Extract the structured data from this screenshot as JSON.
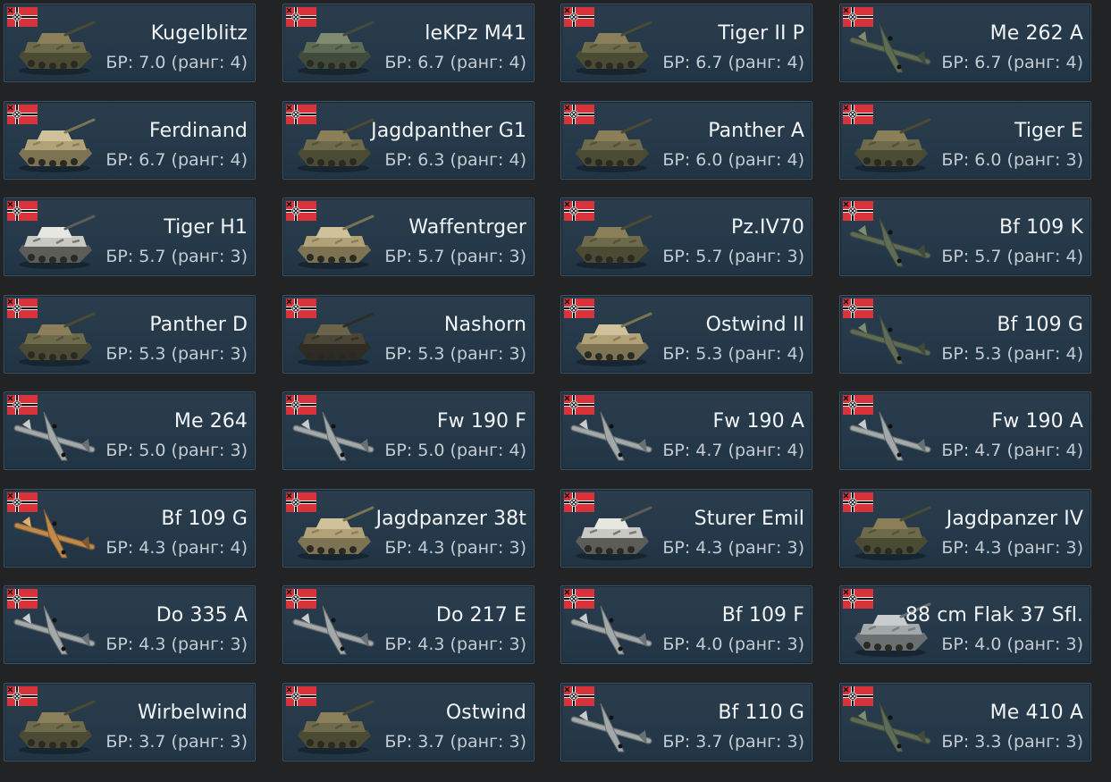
{
  "colors": {
    "background": "#222325",
    "card": "#25394a",
    "card_border": "#3a5366",
    "name_text": "#f2f4f5",
    "br_text": "#c4ccd2",
    "flag_red": "#d8323a"
  },
  "flag_icon": "german-war-flag-icon",
  "vehicles": [
    {
      "name": "Kugelblitz",
      "br": "БР: 7.0 (ранг: 4)",
      "kind": "tank",
      "tone": "camo"
    },
    {
      "name": "leKPz M41",
      "br": "БР: 6.7 (ранг: 4)",
      "kind": "tank",
      "tone": "green"
    },
    {
      "name": "Tiger II P",
      "br": "БР: 6.7 (ранг: 4)",
      "kind": "tank",
      "tone": "camo"
    },
    {
      "name": "Me 262 A",
      "br": "БР: 6.7 (ранг: 4)",
      "kind": "plane",
      "tone": "green"
    },
    {
      "name": "Ferdinand",
      "br": "БР: 6.7 (ранг: 4)",
      "kind": "tank",
      "tone": "sand"
    },
    {
      "name": "Jagdpanther G1",
      "br": "БР: 6.3 (ранг: 4)",
      "kind": "tank",
      "tone": "camo"
    },
    {
      "name": "Panther A",
      "br": "БР: 6.0 (ранг: 4)",
      "kind": "tank",
      "tone": "camo"
    },
    {
      "name": "Tiger E",
      "br": "БР: 6.0 (ранг: 3)",
      "kind": "tank",
      "tone": "camo"
    },
    {
      "name": "Tiger H1",
      "br": "БР: 5.7 (ранг: 3)",
      "kind": "tank",
      "tone": "white"
    },
    {
      "name": "Waffentrger",
      "br": "БР: 5.7 (ранг: 3)",
      "kind": "tank",
      "tone": "sand"
    },
    {
      "name": "Pz.IV70",
      "br": "БР: 5.7 (ранг: 3)",
      "kind": "tank",
      "tone": "camo"
    },
    {
      "name": "Bf 109 K",
      "br": "БР: 5.7 (ранг: 4)",
      "kind": "plane",
      "tone": "green"
    },
    {
      "name": "Panther D",
      "br": "БР: 5.3 (ранг: 3)",
      "kind": "tank",
      "tone": "camo"
    },
    {
      "name": "Nashorn",
      "br": "БР: 5.3 (ранг: 3)",
      "kind": "tank",
      "tone": "dark"
    },
    {
      "name": "Ostwind II",
      "br": "БР: 5.3 (ранг: 4)",
      "kind": "tank",
      "tone": "sand"
    },
    {
      "name": "Bf 109 G",
      "br": "БР: 5.3 (ранг: 4)",
      "kind": "plane",
      "tone": "green"
    },
    {
      "name": "Me 264",
      "br": "БР: 5.0 (ранг: 3)",
      "kind": "plane",
      "tone": "gray"
    },
    {
      "name": "Fw 190 F",
      "br": "БР: 5.0 (ранг: 4)",
      "kind": "plane",
      "tone": "gray"
    },
    {
      "name": "Fw 190 A",
      "br": "БР: 4.7 (ранг: 4)",
      "kind": "plane",
      "tone": "gray"
    },
    {
      "name": "Fw 190 A",
      "br": "БР: 4.7 (ранг: 4)",
      "kind": "plane",
      "tone": "gray"
    },
    {
      "name": "Bf 109 G",
      "br": "БР: 4.3 (ранг: 4)",
      "kind": "plane",
      "tone": "tan"
    },
    {
      "name": "Jagdpanzer 38t",
      "br": "БР: 4.3 (ранг: 3)",
      "kind": "tank",
      "tone": "sand"
    },
    {
      "name": "Sturer Emil",
      "br": "БР: 4.3 (ранг: 3)",
      "kind": "tank",
      "tone": "white"
    },
    {
      "name": "Jagdpanzer IV",
      "br": "БР: 4.3 (ранг: 3)",
      "kind": "tank",
      "tone": "camo"
    },
    {
      "name": "Do 335 A",
      "br": "БР: 4.3 (ранг: 3)",
      "kind": "plane",
      "tone": "gray"
    },
    {
      "name": "Do 217 E",
      "br": "БР: 4.3 (ранг: 3)",
      "kind": "plane",
      "tone": "gray"
    },
    {
      "name": "Bf 109 F",
      "br": "БР: 4.0 (ранг: 3)",
      "kind": "plane",
      "tone": "gray"
    },
    {
      "name": "88 cm Flak 37 Sfl.",
      "br": "БР: 4.0 (ранг: 3)",
      "kind": "tank",
      "tone": "gray"
    },
    {
      "name": "Wirbelwind",
      "br": "БР: 3.7 (ранг: 3)",
      "kind": "tank",
      "tone": "camo"
    },
    {
      "name": "Ostwind",
      "br": "БР: 3.7 (ранг: 3)",
      "kind": "tank",
      "tone": "camo"
    },
    {
      "name": "Bf 110 G",
      "br": "БР: 3.7 (ранг: 3)",
      "kind": "plane",
      "tone": "gray"
    },
    {
      "name": "Me 410 A",
      "br": "БР: 3.3 (ранг: 3)",
      "kind": "plane",
      "tone": "green"
    }
  ]
}
